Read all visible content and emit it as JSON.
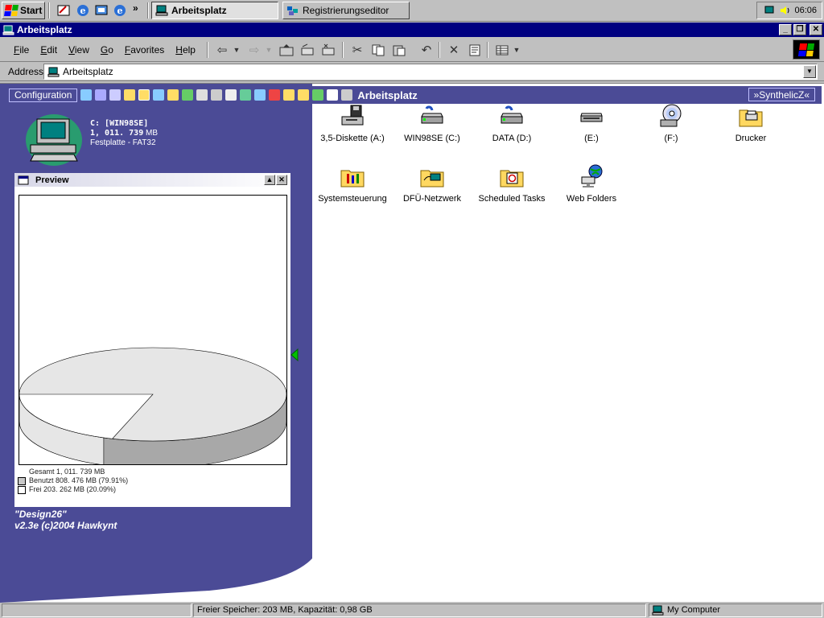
{
  "taskbar": {
    "start_label": "Start",
    "chevron": "»",
    "tasks": [
      {
        "label": "Arbeitsplatz",
        "active": true
      },
      {
        "label": "Registrierungseditor",
        "active": false
      }
    ],
    "clock": "06:06"
  },
  "window": {
    "title": "Arbeitsplatz",
    "menus": [
      {
        "key": "F",
        "rest": "ile"
      },
      {
        "key": "E",
        "rest": "dit"
      },
      {
        "key": "V",
        "rest": "iew"
      },
      {
        "key": "G",
        "rest": "o"
      },
      {
        "key": "F",
        "rest": "avorites",
        "prefix": ""
      },
      {
        "key": "H",
        "rest": "elp"
      }
    ],
    "address_label": "Address",
    "address_value": "Arbeitsplatz"
  },
  "panel": {
    "config_label": "Configuration",
    "strip_title": "Arbeitsplatz",
    "synth_label": "»SynthelicZ«",
    "drive_name": "C: [WIN98SE]",
    "drive_size": "1, 011. 739",
    "drive_size_unit": "MB",
    "drive_type": "Festplatte - FAT32",
    "preview_title": "Preview",
    "legend": {
      "total": "Gesamt 1, 011. 739 MB",
      "used": "Benutzt 808. 476 MB (79.91%)",
      "free": "Frei 203. 262 MB (20.09%)"
    },
    "credits_line1": "\"Design26\"",
    "credits_line2": "v2.3e (c)2004 Hawkynt"
  },
  "chart_data": {
    "type": "pie",
    "categories": [
      "Benutzt",
      "Frei"
    ],
    "values": [
      79.91,
      20.09
    ],
    "colors": [
      "#e6e6e6",
      "#ffffff"
    ]
  },
  "drives": [
    {
      "label": "3,5-Diskette (A:)",
      "icon": "floppy-drive-icon"
    },
    {
      "label": "WIN98SE (C:)",
      "icon": "hard-drive-icon"
    },
    {
      "label": "DATA (D:)",
      "icon": "hard-drive-icon"
    },
    {
      "label": "(E:)",
      "icon": "removable-drive-icon"
    },
    {
      "label": "(F:)",
      "icon": "cd-drive-icon"
    },
    {
      "label": "Drucker",
      "icon": "printers-folder-icon"
    },
    {
      "label": "Systemsteuerung",
      "icon": "control-panel-folder-icon"
    },
    {
      "label": "DFÜ-Netzwerk",
      "icon": "dialup-network-folder-icon"
    },
    {
      "label": "Scheduled Tasks",
      "icon": "scheduled-tasks-folder-icon"
    },
    {
      "label": "Web Folders",
      "icon": "web-folders-icon"
    }
  ],
  "status": {
    "info": "Freier Speicher: 203 MB, Kapazität: 0,98 GB",
    "zone": "My Computer"
  }
}
